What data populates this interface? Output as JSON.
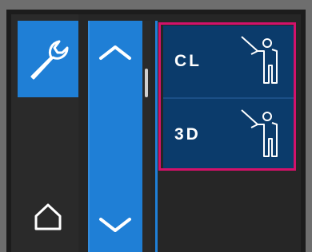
{
  "left_panel": {
    "tool_icon": "wrench-icon",
    "home_icon": "home-icon"
  },
  "scroller": {
    "up_icon": "chevron-up-icon",
    "down_icon": "chevron-down-icon"
  },
  "modes": {
    "items": [
      {
        "label": "CL",
        "icon": "person-pointing-icon"
      },
      {
        "label": "3D",
        "icon": "person-pointing-icon"
      }
    ]
  },
  "colors": {
    "accent": "#1f7fd6",
    "item_bg": "#0b3b6b",
    "selection": "#d4116a"
  }
}
